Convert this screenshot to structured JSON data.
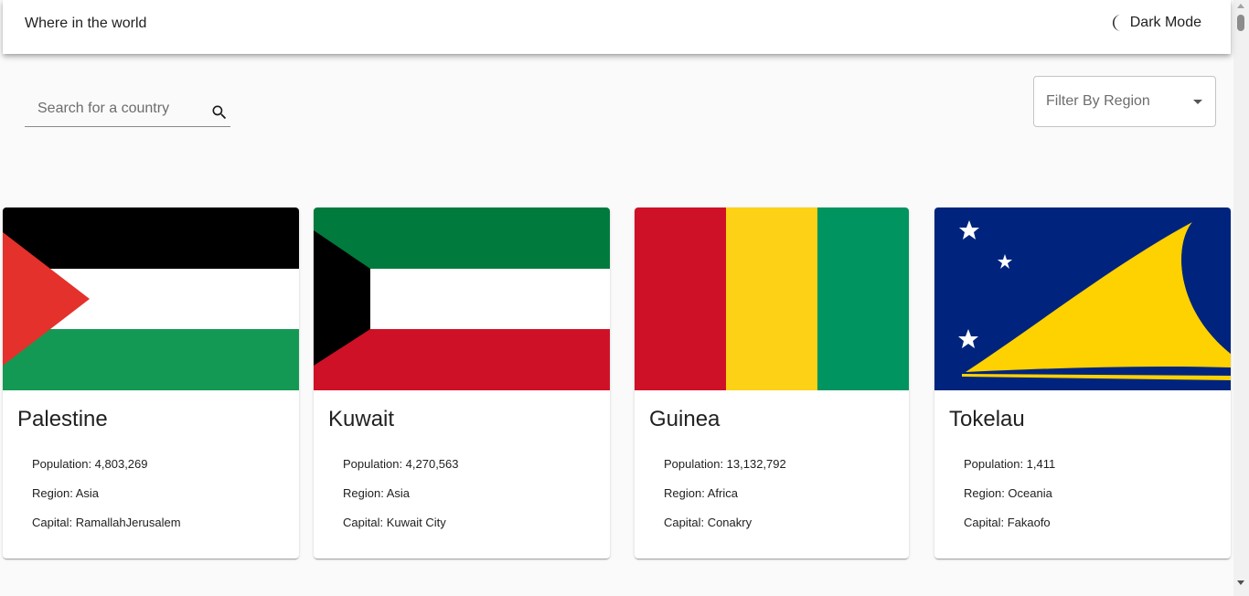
{
  "header": {
    "title": "Where in the world",
    "dark_mode_label": "Dark Mode",
    "dark_mode_icon": "moon-icon"
  },
  "search": {
    "placeholder": "Search for a country",
    "value": "",
    "icon": "search-icon"
  },
  "filter": {
    "label": "Filter By Region",
    "icon": "chevron-down-icon"
  },
  "countries": [
    {
      "name": "Palestine",
      "population": "Population: 4,803,269",
      "region": "Region: Asia",
      "capital": "Capital: RamallahJerusalem",
      "flag_colors": [
        "#000000",
        "#ffffff",
        "#149954",
        "#e4312b"
      ]
    },
    {
      "name": "Kuwait",
      "population": "Population: 4,270,563",
      "region": "Region: Asia",
      "capital": "Capital: Kuwait City",
      "flag_colors": [
        "#007a3d",
        "#ffffff",
        "#ce1126",
        "#000000"
      ]
    },
    {
      "name": "Guinea",
      "population": "Population: 13,132,792",
      "region": "Region: Africa",
      "capital": "Capital: Conakry",
      "flag_colors": [
        "#ce1126",
        "#fcd116",
        "#009460"
      ]
    },
    {
      "name": "Tokelau",
      "population": "Population: 1,411",
      "region": "Region: Oceania",
      "capital": "Capital: Fakaofo",
      "flag_colors": [
        "#00247d",
        "#fed100",
        "#ffffff"
      ]
    }
  ],
  "theme": {
    "appbar_bg": "#ffffff",
    "page_bg": "#fafafa",
    "text": "#212121"
  }
}
